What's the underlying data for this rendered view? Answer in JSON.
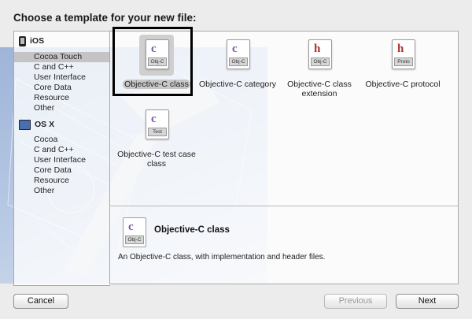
{
  "dialog": {
    "heading": "Choose a template for your new file:"
  },
  "sidebar": {
    "sections": [
      {
        "title": "iOS",
        "items": [
          "Cocoa Touch",
          "C and C++",
          "User Interface",
          "Core Data",
          "Resource",
          "Other"
        ],
        "selected_index": 0
      },
      {
        "title": "OS X",
        "items": [
          "Cocoa",
          "C and C++",
          "User Interface",
          "Core Data",
          "Resource",
          "Other"
        ]
      }
    ]
  },
  "templates": [
    {
      "label": "Objective-C class",
      "glyph": "c",
      "tag": "Obj-C",
      "selected": true
    },
    {
      "label": "Objective-C category",
      "glyph": "c",
      "tag": "Obj-C"
    },
    {
      "label": "Objective-C class extension",
      "glyph": "h",
      "tag": "Obj-C"
    },
    {
      "label": "Objective-C protocol",
      "glyph": "h",
      "tag": "Proto"
    },
    {
      "label": "Objective-C test case class",
      "glyph": "c",
      "tag": "Test"
    }
  ],
  "detail": {
    "title": "Objective-C class",
    "description": "An Objective-C class, with implementation and header files.",
    "icon_tag": "Obj-C",
    "icon_glyph": "c"
  },
  "buttons": {
    "cancel": "Cancel",
    "previous": "Previous",
    "next": "Next"
  },
  "colors": {
    "selection": "#c4c4c4",
    "focus_frame": "#000000"
  }
}
